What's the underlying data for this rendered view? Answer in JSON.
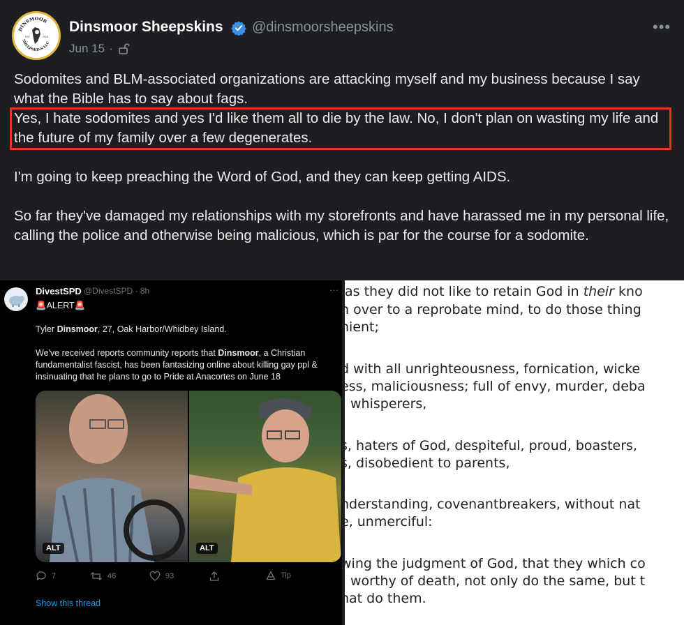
{
  "post": {
    "author_name": "Dinsmoor Sheepskins",
    "author_handle": "@dinsmoorsheepskins",
    "date": "Jun 15",
    "date_separator": "·",
    "more_label": "•••",
    "avatar_text_top": "DINSMOOR",
    "avatar_text_bottom": "SHEEPSKINS LLC",
    "avatar_est": "EST.",
    "avatar_year": "2018",
    "paragraphs": [
      "Sodomites and BLM-associated organizations are attacking myself and my business because I say what the Bible has to say about fags.",
      "Yes, I hate sodomites and yes I'd like them all to die by the law. No, I don't plan on wasting my life and the future of my family over a few degenerates.",
      "I'm going to keep preaching the Word of God, and they can keep getting AIDS.",
      "So far they've damaged my relationships with my storefronts and have harassed me in my personal life, calling the police and otherwise being malicious, which is par for the course for a sodomite."
    ]
  },
  "embedded_tweet": {
    "name": "DivestSPD",
    "handle": "@DivestSPD · 8h",
    "dots": "···",
    "alert_line": "🚨ALERT🚨",
    "line_name_prefix": "Tyler ",
    "line_name_bold": "Dinsmoor",
    "line_name_suffix": ", 27, Oak Harbor/Whidbey Island.",
    "report_prefix": "We've received reports community reports that ",
    "report_bold": "Dinsmoor",
    "report_suffix": ", a Christian fundamentalist fascist, has been fantasizing online about killing gay ppl & insinuating that he plans to go to Pride at Anacortes on June 18",
    "alt_label_1": "ALT",
    "alt_label_2": "ALT",
    "replies": "7",
    "retweets": "46",
    "likes": "93",
    "tip": "Tip",
    "show_thread": "Show this thread"
  },
  "verse_lines": [
    {
      "pre": "as they did not like to retain God in ",
      "em": "their",
      "post": " kno"
    },
    {
      "pre": "n over to a reprobate mind, to do those thing",
      "em": "",
      "post": ""
    },
    {
      "pre": "nient;",
      "em": "",
      "post": ""
    },
    {
      "pre": "d with all unrighteousness, fornication, wicke",
      "em": "",
      "post": ""
    },
    {
      "pre": "ess, maliciousness; full of envy, murder, deba",
      "em": "",
      "post": ""
    },
    {
      "pre": " whisperers,",
      "em": "",
      "post": ""
    },
    {
      "pre": "s, haters of God, despiteful, proud, boasters,",
      "em": "",
      "post": ""
    },
    {
      "pre": "s, disobedient to parents,",
      "em": "",
      "post": ""
    },
    {
      "pre": "nderstanding, covenantbreakers, without nat",
      "em": "",
      "post": ""
    },
    {
      "pre": "e, unmerciful:",
      "em": "",
      "post": ""
    },
    {
      "pre": "wing the judgment of God, that they which co",
      "em": "",
      "post": ""
    },
    {
      "pre": " worthy of death, not only do the same, but t",
      "em": "",
      "post": ""
    },
    {
      "pre": "nat do them.",
      "em": "",
      "post": ""
    }
  ]
}
